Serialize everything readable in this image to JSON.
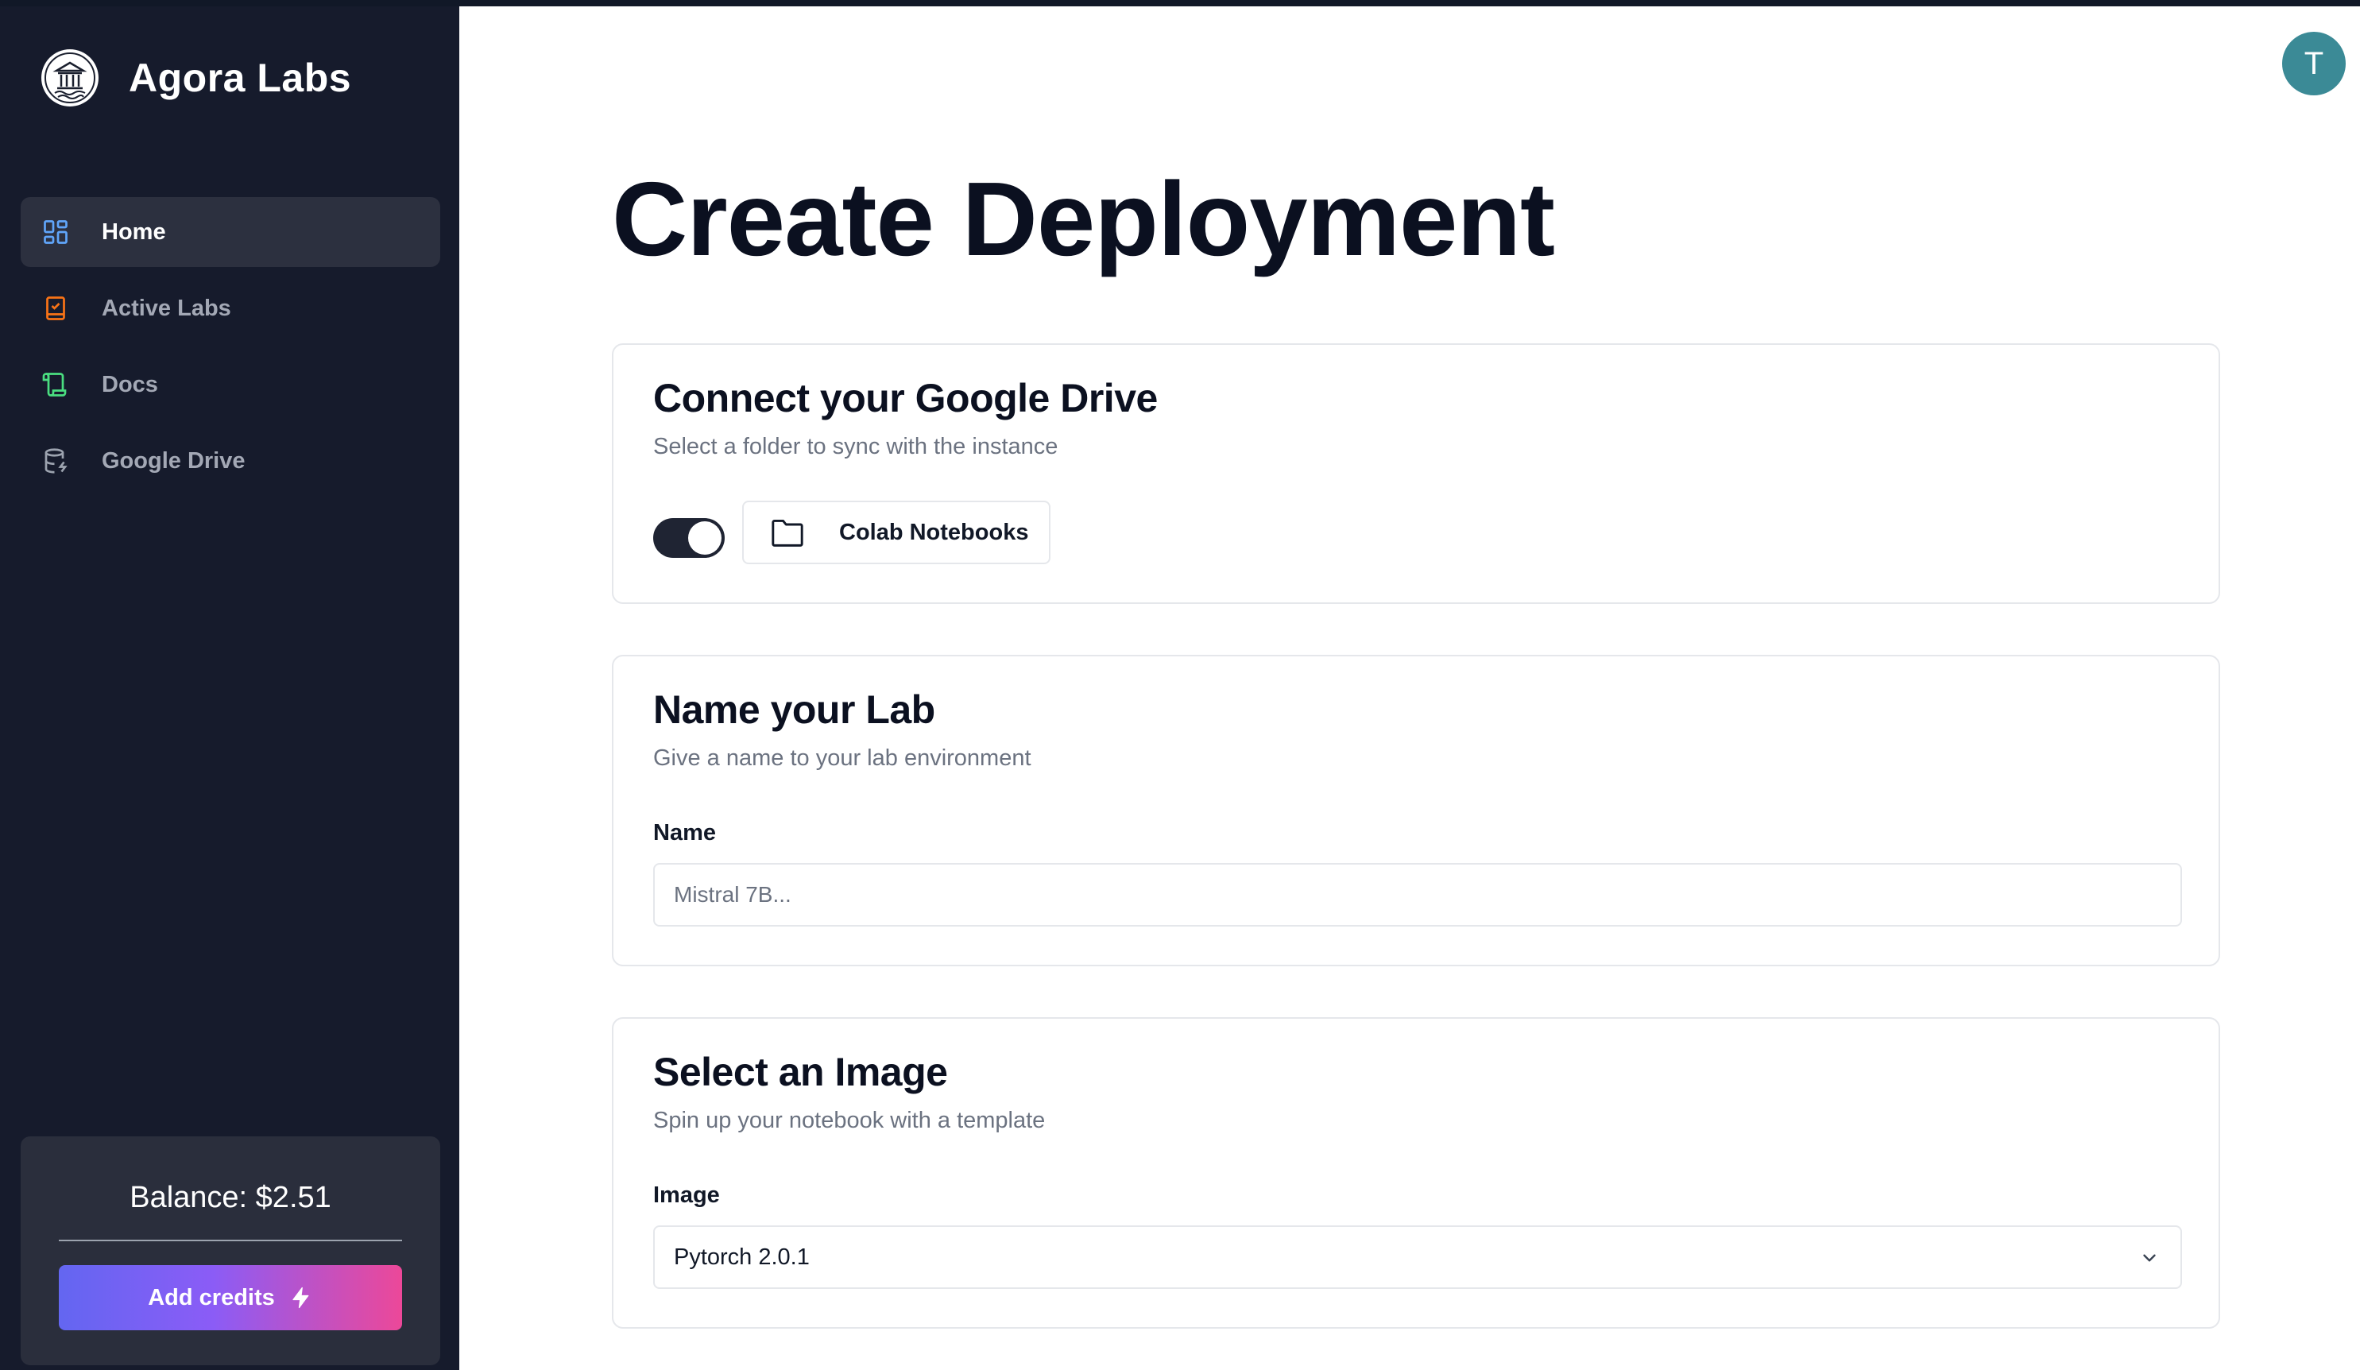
{
  "brand": {
    "name": "Agora Labs"
  },
  "sidebar": {
    "items": [
      {
        "label": "Home",
        "icon": "grid-icon",
        "color": "#60a5fa",
        "active": true
      },
      {
        "label": "Active Labs",
        "icon": "clipboard-check-icon",
        "color": "#f97316",
        "active": false
      },
      {
        "label": "Docs",
        "icon": "scroll-icon",
        "color": "#4ade80",
        "active": false
      },
      {
        "label": "Google Drive",
        "icon": "database-icon",
        "color": "#9ca3af",
        "active": false
      }
    ],
    "balance": "Balance: $2.51",
    "add_credits_label": "Add credits"
  },
  "user": {
    "avatar_initial": "T",
    "avatar_color": "#3b8a96"
  },
  "main": {
    "title": "Create Deployment",
    "drive_card": {
      "title": "Connect your Google Drive",
      "subtitle": "Select a folder to sync with the instance",
      "toggle_on": true,
      "folder_label": "Colab Notebooks"
    },
    "name_card": {
      "title": "Name your Lab",
      "subtitle": "Give a name to your lab environment",
      "field_label": "Name",
      "placeholder": "Mistral 7B...",
      "value": ""
    },
    "image_card": {
      "title": "Select an Image",
      "subtitle": "Spin up your notebook with a template",
      "field_label": "Image",
      "selected": "Pytorch 2.0.1"
    }
  }
}
